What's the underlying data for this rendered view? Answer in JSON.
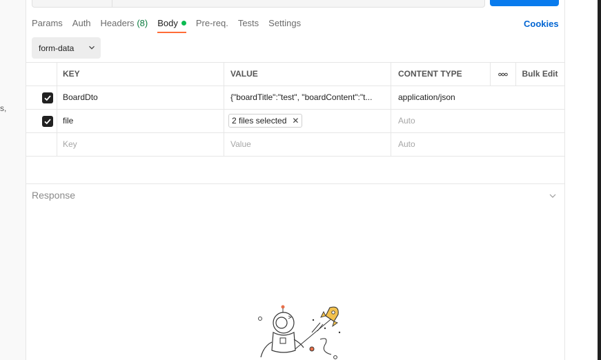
{
  "request_tabs": {
    "params": "Params",
    "auth": "Auth",
    "headers": "Headers",
    "headers_count": "(8)",
    "body": "Body",
    "prereq": "Pre-req.",
    "tests": "Tests",
    "settings": "Settings"
  },
  "cookies_label": "Cookies",
  "body_mode": {
    "selected": "form-data"
  },
  "table": {
    "headers": {
      "key": "KEY",
      "value": "VALUE",
      "content_type": "CONTENT TYPE",
      "bulk_edit": "Bulk Edit"
    },
    "rows": [
      {
        "checked": true,
        "key": "BoardDto",
        "value": "{\"boardTitle\":\"test\", \"boardContent\":\"t...",
        "content_type": "application/json"
      },
      {
        "checked": true,
        "key": "file",
        "value": "2 files selected",
        "content_type": "Auto"
      }
    ],
    "new_row": {
      "key_placeholder": "Key",
      "value_placeholder": "Value",
      "content_type_placeholder": "Auto"
    }
  },
  "response": {
    "title": "Response"
  },
  "colors": {
    "active_tab_underline": "#ff6c37",
    "body_dot": "#0cbb52",
    "headers_count": "#0a7b3e",
    "link_blue": "#0265d2",
    "send_button": "#097bed"
  },
  "icons": {
    "dropdown": "chevron-down-icon",
    "checkbox": "checkmark-icon",
    "remove_file": "close-icon",
    "more": "more-horizontal-icon",
    "response_toggle": "chevron-down-icon",
    "illustration": "astronaut-rocket-illustration"
  }
}
